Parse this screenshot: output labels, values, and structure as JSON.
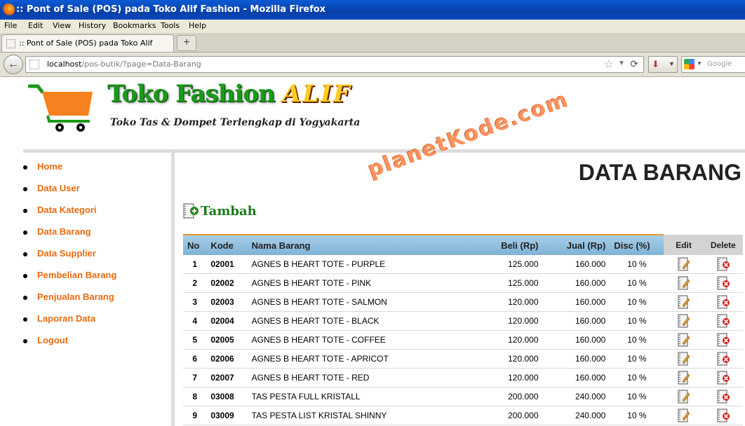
{
  "browser": {
    "window_title": ":: Pont of Sale (POS) pada Toko Alif Fashion - Mozilla Firefox",
    "menu": [
      "File",
      "Edit",
      "View",
      "History",
      "Bookmarks",
      "Tools",
      "Help"
    ],
    "tab_title": ":: Pont of Sale (POS) pada Toko Alif Fashion",
    "new_tab": "+",
    "url_host": "localhost",
    "url_path": "/pos-butik/?page=Data-Barang",
    "search_placeholder": "Google"
  },
  "header": {
    "logo_title": "Toko Fashion",
    "logo_title_accent": "ALIF",
    "tagline": "Toko Tas & Dompet Terlengkap di Yogyakarta",
    "cart_color": "#f5821f"
  },
  "sidebar": {
    "items": [
      {
        "label": "Home"
      },
      {
        "label": "Data User"
      },
      {
        "label": "Data Kategori"
      },
      {
        "label": "Data Barang"
      },
      {
        "label": "Data Supplier"
      },
      {
        "label": "Pembelian Barang"
      },
      {
        "label": "Penjualan Barang"
      },
      {
        "label": "Laporan Data"
      },
      {
        "label": "Logout"
      }
    ]
  },
  "main": {
    "heading": "DATA BARANG",
    "watermark": "planetKode.com",
    "add_label": "Tambah",
    "table": {
      "columns": [
        "No",
        "Kode",
        "Nama Barang",
        "Beli (Rp)",
        "Jual (Rp)",
        "Disc (%)",
        "Edit",
        "Delete"
      ],
      "rows": [
        {
          "no": "1",
          "kode": "02001",
          "nama": "AGNES B HEART TOTE - PURPLE",
          "beli": "125.000",
          "jual": "160.000",
          "disc": "10 %"
        },
        {
          "no": "2",
          "kode": "02002",
          "nama": "AGNES B HEART TOTE - PINK",
          "beli": "125.000",
          "jual": "160.000",
          "disc": "10 %"
        },
        {
          "no": "3",
          "kode": "02003",
          "nama": "AGNES B HEART TOTE - SALMON",
          "beli": "120.000",
          "jual": "160.000",
          "disc": "10 %"
        },
        {
          "no": "4",
          "kode": "02004",
          "nama": "AGNES B HEART TOTE - BLACK",
          "beli": "120.000",
          "jual": "160.000",
          "disc": "10 %"
        },
        {
          "no": "5",
          "kode": "02005",
          "nama": "AGNES B HEART TOTE - COFFEE",
          "beli": "120.000",
          "jual": "160.000",
          "disc": "10 %"
        },
        {
          "no": "6",
          "kode": "02006",
          "nama": "AGNES B HEART TOTE - APRICOT",
          "beli": "120.000",
          "jual": "160.000",
          "disc": "10 %"
        },
        {
          "no": "7",
          "kode": "02007",
          "nama": "AGNES B HEART TOTE - RED",
          "beli": "120.000",
          "jual": "160.000",
          "disc": "10 %"
        },
        {
          "no": "8",
          "kode": "03008",
          "nama": "TAS PESTA FULL KRISTALL",
          "beli": "200.000",
          "jual": "240.000",
          "disc": "10 %"
        },
        {
          "no": "9",
          "kode": "03009",
          "nama": "TAS PESTA LIST KRISTAL SHINNY",
          "beli": "200.000",
          "jual": "240.000",
          "disc": "10 %"
        }
      ]
    }
  },
  "colors": {
    "menu_link": "#e86a10",
    "header_blue": "#7fb3d6",
    "header_orange_rule": "#e69a2a",
    "logo_green": "#1a9a1a",
    "logo_gold": "#ffcc22"
  }
}
